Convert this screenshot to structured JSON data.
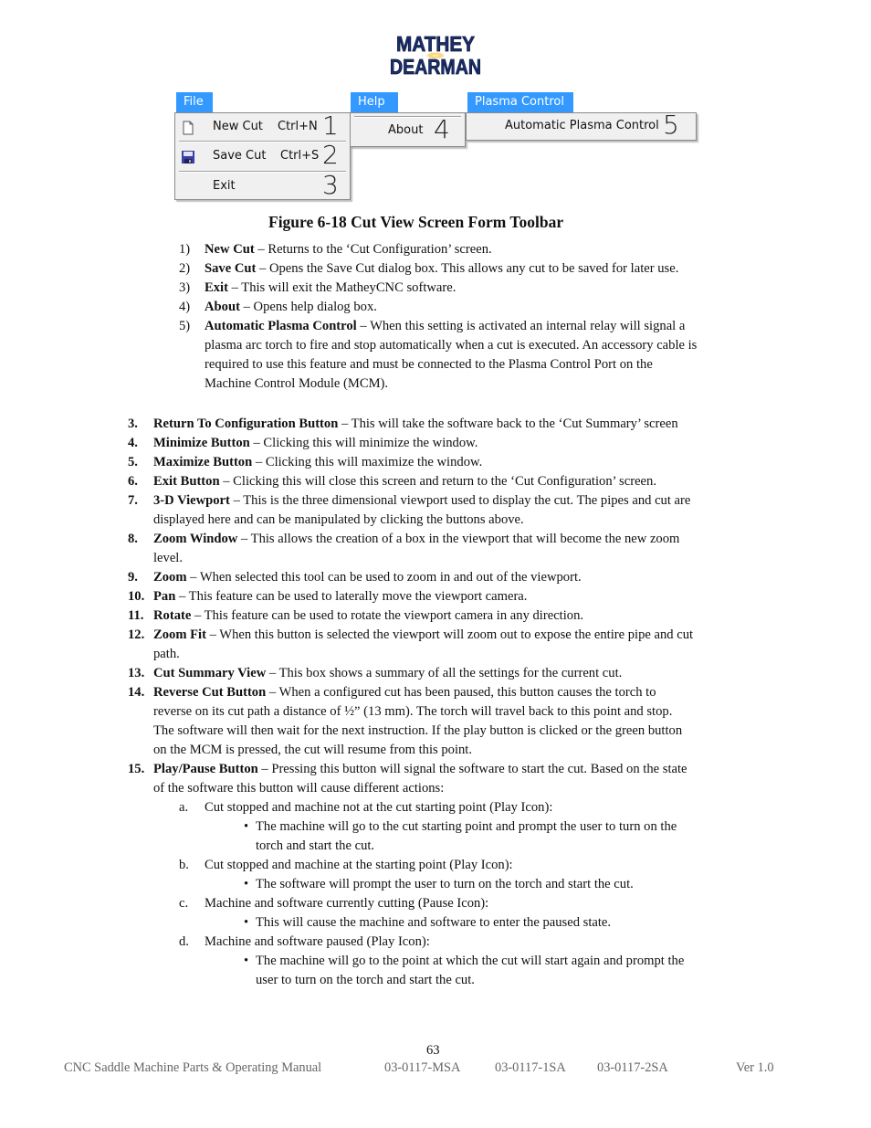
{
  "logo": {
    "line1": "MATHEY",
    "line2": "DEARMAN"
  },
  "toolbar": {
    "file_menu": {
      "title": "File",
      "items": [
        {
          "label": "New Cut",
          "shortcut": "Ctrl+N",
          "callout": "1",
          "icon": "new-document-icon"
        },
        {
          "label": "Save Cut",
          "shortcut": "Ctrl+S",
          "callout": "2",
          "icon": "floppy-disk-icon"
        },
        {
          "label": "Exit",
          "shortcut": "",
          "callout": "3",
          "icon": ""
        }
      ]
    },
    "help_menu": {
      "title": "Help",
      "items": [
        {
          "label": "About",
          "callout": "4"
        }
      ]
    },
    "plasma_menu": {
      "title": "Plasma Control",
      "items": [
        {
          "label": "Automatic Plasma Control",
          "callout": "5"
        }
      ]
    },
    "accent_color": "#3399ff"
  },
  "caption": "Figure 6-18 Cut View Screen Form Toolbar",
  "toolbar_items": [
    {
      "num": "1)",
      "term": "New Cut",
      "lines": [
        "– Returns to the ‘Cut Configuration’ screen."
      ]
    },
    {
      "num": "2)",
      "term": "Save Cut",
      "lines": [
        "– Opens the Save Cut dialog box.  This allows any cut to be saved for later use."
      ]
    },
    {
      "num": "3)",
      "term": "Exit",
      "lines": [
        "– This will exit the MatheyCNC software."
      ]
    },
    {
      "num": "4)",
      "term": "About",
      "lines": [
        "– Opens help dialog box."
      ]
    },
    {
      "num": "5)",
      "term": "Automatic Plasma Control",
      "lines": [
        "– When this setting is activated an internal relay will signal a",
        "plasma arc torch to fire and stop automatically when a cut is executed.  An accessory cable is",
        "required to use this feature and must be connected to the Plasma Control Port on the",
        "Machine Control Module (MCM)."
      ]
    }
  ],
  "main_items": [
    {
      "num": "3.",
      "term": "Return To Configuration Button",
      "lines": [
        "– This will take the software back to the ‘Cut Summary’ screen"
      ]
    },
    {
      "num": "4.",
      "term": "Minimize Button",
      "lines": [
        "– Clicking this will minimize the window."
      ]
    },
    {
      "num": "5.",
      "term": "Maximize Button",
      "lines": [
        "– Clicking this will maximize the window."
      ]
    },
    {
      "num": "6.",
      "term": "Exit Button",
      "lines": [
        "– Clicking this will close this screen and return to the ‘Cut Configuration’ screen."
      ]
    },
    {
      "num": "7.",
      "term": "3-D Viewport",
      "lines": [
        "– This is the three dimensional viewport used to display the cut.  The pipes and cut are",
        "displayed here and can be manipulated by clicking the buttons above."
      ]
    },
    {
      "num": "8.",
      "term": "Zoom Window",
      "lines": [
        "– This allows the creation of a box in the viewport that will become the new zoom",
        "level."
      ]
    },
    {
      "num": "9.",
      "term": "Zoom",
      "lines": [
        "– When selected this tool can be used to zoom in and out of the viewport."
      ]
    },
    {
      "num": "10.",
      "term": "Pan",
      "lines": [
        "– This feature can be used to laterally move the viewport camera."
      ]
    },
    {
      "num": "11.",
      "term": "Rotate",
      "lines": [
        "– This feature can be used to rotate the viewport camera in any direction."
      ]
    },
    {
      "num": "12.",
      "term": "Zoom Fit",
      "lines": [
        "– When this button is selected the viewport will zoom out to expose the entire pipe and cut",
        "path."
      ]
    },
    {
      "num": "13.",
      "term": "Cut Summary View",
      "lines": [
        "– This box shows a summary of all the settings for the current cut."
      ]
    },
    {
      "num": "14.",
      "term": "Reverse Cut Button",
      "lines": [
        "– When a configured cut has been paused, this button causes the torch to",
        "reverse on its cut path a distance of ½” (13 mm).  The torch will travel back to this point and stop.",
        "The software will then wait for the next instruction. If the play button is clicked or the green button",
        "on the MCM is pressed, the cut will resume from this point."
      ]
    },
    {
      "num": "15.",
      "term": "Play/Pause Button",
      "lines": [
        "– Pressing this button will signal the software to start the cut.  Based on the state",
        "of the software this button will cause different actions:"
      ]
    }
  ],
  "sub_items": [
    {
      "letter": "a.",
      "text": "Cut stopped and machine not at the cut starting point (Play Icon):",
      "bullet": [
        "The machine will go to the cut starting point and prompt the user to turn on the",
        "torch and start the cut."
      ]
    },
    {
      "letter": "b.",
      "text": "Cut stopped and machine at the starting point (Play Icon):",
      "bullet": [
        "The software will prompt the user to turn on the torch and start the cut."
      ]
    },
    {
      "letter": "c.",
      "text": "Machine and software currently cutting (Pause Icon):",
      "bullet": [
        "This will cause the machine and software to enter the paused state."
      ]
    },
    {
      "letter": "d.",
      "text": "Machine and software paused (Play Icon):",
      "bullet": [
        "The machine will go to the point at which the cut will start again and prompt the",
        "user to turn on the torch and start the cut."
      ]
    }
  ],
  "footer": {
    "page_number": "63",
    "manual_title": "CNC Saddle Machine Parts & Operating Manual",
    "part_numbers": [
      "03-0117-MSA",
      "03-0117-1SA",
      "03-0117-2SA"
    ],
    "version": "Ver 1.0"
  }
}
